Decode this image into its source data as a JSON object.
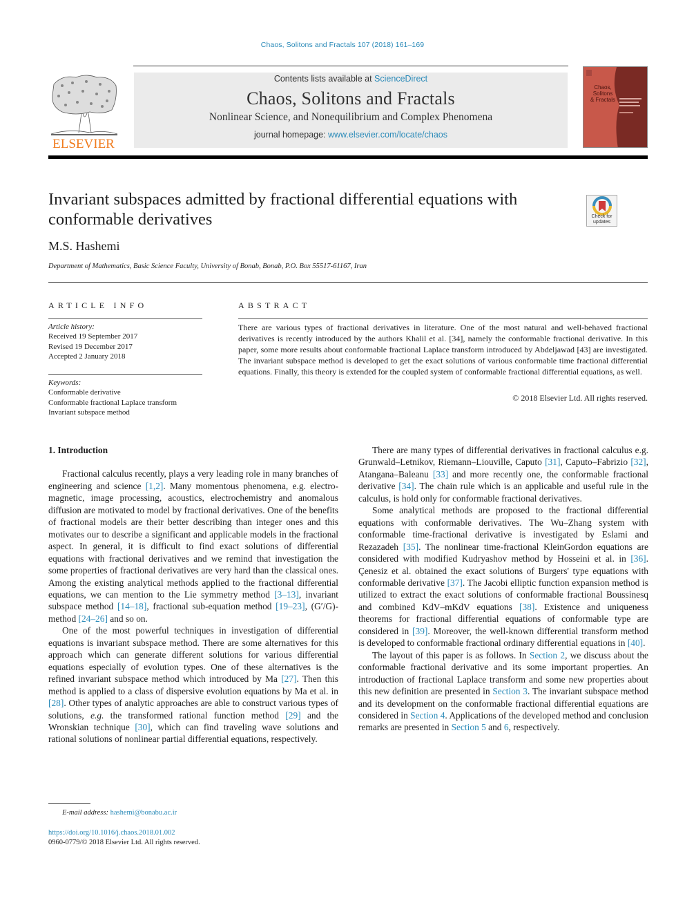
{
  "running_head": "Chaos, Solitons and Fractals 107 (2018) 161–169",
  "masthead": {
    "contents_prefix": "Contents lists available at ",
    "contents_link": "ScienceDirect",
    "journal_title": "Chaos, Solitons and Fractals",
    "journal_subtitle": "Nonlinear Science, and Nonequilibrium and Complex Phenomena",
    "homepage_prefix": "journal homepage: ",
    "homepage_link": "www.elsevier.com/locate/chaos",
    "publisher_logo": "ELSEVIER",
    "cover_title_lines": [
      "Chaos,",
      "Solitons",
      "& Fractals"
    ]
  },
  "crossmark": {
    "label_line1": "Check for",
    "label_line2": "updates"
  },
  "article": {
    "title": "Invariant subspaces admitted by fractional differential equations with conformable derivatives",
    "author": "M.S. Hashemi",
    "affiliation": "Department of Mathematics, Basic Science Faculty, University of Bonab, Bonab, P.O. Box 55517-61167, Iran"
  },
  "article_info": {
    "heading": "ARTICLE INFO",
    "history_label": "Article history:",
    "history": [
      "Received 19 September 2017",
      "Revised 19 December 2017",
      "Accepted 2 January 2018"
    ],
    "keywords_label": "Keywords:",
    "keywords": [
      "Conformable derivative",
      "Conformable fractional Laplace transform",
      "Invariant subspace method"
    ]
  },
  "abstract": {
    "heading": "ABSTRACT",
    "text": "There are various types of fractional derivatives in literature. One of the most natural and well-behaved fractional derivatives is recently introduced by the authors Khalil et al. [34], namely the conformable fractional derivative. In this paper, some more results about conformable fractional Laplace transform introduced by Abdeljawad [43] are investigated. The invariant subspace method is developed to get the exact solutions of various conformable time fractional differential equations. Finally, this theory is extended for the coupled system of conformable fractional differential equations, as well.",
    "copyright": "© 2018 Elsevier Ltd. All rights reserved."
  },
  "body": {
    "section_heading": "1. Introduction",
    "p1": {
      "t1": "Fractional calculus recently, plays a very leading role in many branches of engineering and science ",
      "r1": "[1,2]",
      "t2": ". Many momentous phenomena, e.g. electro-magnetic, image processing, acoustics, electrochemistry and anomalous diffusion are motivated to model by fractional derivatives. One of the benefits of fractional models are their better describing than integer ones and this motivates our to describe a significant and applicable models in the fractional aspect. In general, it is difficult to find exact solutions of differential equations with fractional derivatives and we remind that investigation the some properties of fractional derivatives are very hard than the classical ones. Among the existing analytical methods applied to the fractional differential equations, we can mention to the Lie symmetry method ",
      "r2": "[3–13]",
      "t3": ", invariant subspace method ",
      "r3": "[14–18]",
      "t4": ", fractional sub-equation method ",
      "r4": "[19–23]",
      "t5": ", (G′/G)-method ",
      "r5": "[24–26]",
      "t6": " and so on."
    },
    "p2": {
      "t1": "One of the most powerful techniques in investigation of differential equations is invariant subspace method. There are some alternatives for this approach which can generate different solutions for various differential equations especially of evolution types. One of these alternatives is the refined invariant subspace method which introduced by Ma ",
      "r1": "[27]",
      "t2": ". Then this method is applied to a class of dispersive evolution equations by Ma et al. in ",
      "r2": "[28]",
      "t3": ". Other types of analytic approaches are able to construct various types of solutions, ",
      "eg": "e.g.",
      "t4": " the transformed rational function method ",
      "r3": "[29]",
      "t5": " and the Wronskian technique ",
      "r4": "[30]",
      "t6": ", which can find traveling wave solutions and rational solutions of nonlinear partial differential equations, respectively."
    },
    "p3": {
      "t1": "There are many types of differential derivatives in fractional calculus e.g. Grunwald–Letnikov, Riemann–Liouville, Caputo ",
      "r1": "[31]",
      "t2": ", Caputo–Fabrizio ",
      "r2": "[32]",
      "t3": ", Atangana–Baleanu ",
      "r3": "[33]",
      "t4": " and more recently one, the conformable fractional derivative ",
      "r4": "[34]",
      "t5": ". The chain rule which is an applicable and useful rule in the calculus, is hold only for conformable fractional derivatives."
    },
    "p4": {
      "t1": "Some analytical methods are proposed to the fractional differential equations with conformable derivatives. The Wu–Zhang system with conformable time-fractional derivative is investigated by Eslami and Rezazadeh ",
      "r1": "[35]",
      "t2": ". The nonlinear time-fractional KleinGordon equations are considered with modified Kudryashov method by Hosseini et al. in ",
      "r2": "[36]",
      "t3": ". Çenesiz et al. obtained the exact solutions of Burgers' type equations with conformable derivative ",
      "r3": "[37]",
      "t4": ". The Jacobi elliptic function expansion method is utilized to extract the exact solutions of conformable fractional Boussinesq and combined KdV–mKdV equations ",
      "r4": "[38]",
      "t5": ". Existence and uniqueness theorems for fractional differential equations of conformable type are considered in ",
      "r5": "[39]",
      "t6": ". Moreover, the well-known differential transform method is developed to conformable fractional ordinary differential equations in ",
      "r6": "[40]",
      "t7": "."
    },
    "p5": {
      "t1": "The layout of this paper is as follows. In ",
      "s2": "Section 2",
      "t2": ", we discuss about the conformable fractional derivative and its some important properties. An introduction of fractional Laplace transform and some new properties about this new definition are presented in ",
      "s3": "Section 3",
      "t3": ". The invariant subspace method and its development on the conformable fractional differential equations are considered in ",
      "s4": "Section 4",
      "t4": ". Applications of the developed method and conclusion remarks are presented in ",
      "s5": "Section 5",
      "t5": " and ",
      "s6": "6",
      "t6": ", respectively."
    }
  },
  "footnote": {
    "email_label": "E-mail address: ",
    "email": "hashemi@bonabu.ac.ir",
    "doi": "https://doi.org/10.1016/j.chaos.2018.01.002",
    "issn_line": "0960-0779/© 2018 Elsevier Ltd. All rights reserved."
  },
  "colors": {
    "link": "#2a8ab8",
    "elsevier_orange": "#f07b1d",
    "cover_red": "#c8584a"
  }
}
